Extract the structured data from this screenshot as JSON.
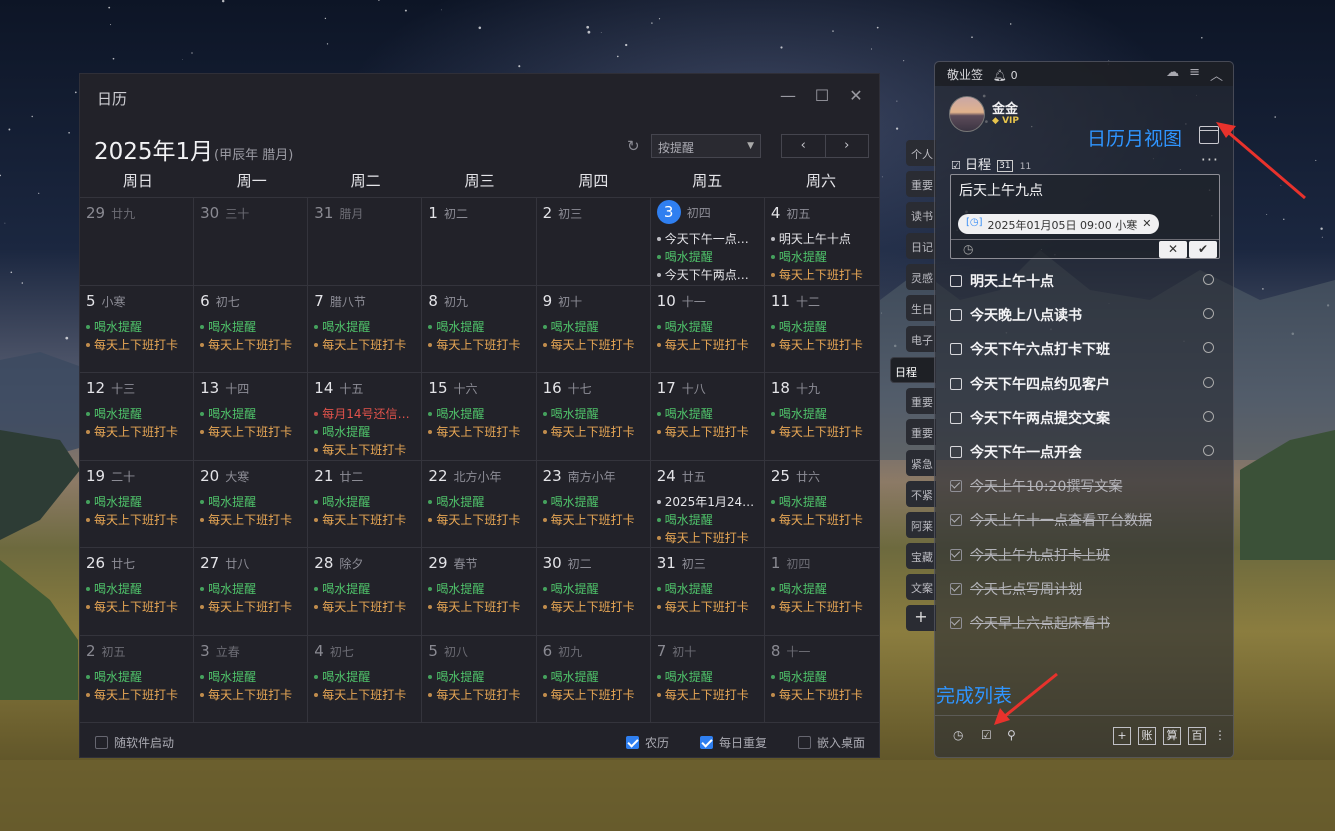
{
  "calendar_window": {
    "title": "日历",
    "month_title": "2025年1月",
    "lunar_subtitle": "(甲辰年 腊月)",
    "filter_select": "按提醒",
    "prev_label": "‹",
    "next_label": "›",
    "weekdays": [
      "周日",
      "周一",
      "周二",
      "周三",
      "周四",
      "周五",
      "周六"
    ],
    "cells": [
      {
        "day": "29",
        "lunar": "廿九",
        "other": true,
        "events": []
      },
      {
        "day": "30",
        "lunar": "三十",
        "other": true,
        "events": []
      },
      {
        "day": "31",
        "lunar": "腊月",
        "other": true,
        "events": []
      },
      {
        "day": "1",
        "lunar": "初二",
        "events": []
      },
      {
        "day": "2",
        "lunar": "初三",
        "events": []
      },
      {
        "day": "3",
        "lunar": "初四",
        "today": true,
        "events": [
          {
            "text": "今天下午一点开会",
            "color": "white"
          },
          {
            "text": "喝水提醒",
            "color": "green"
          },
          {
            "text": "今天下午两点提交文案",
            "color": "white"
          }
        ]
      },
      {
        "day": "4",
        "lunar": "初五",
        "events": [
          {
            "text": "明天上午十点",
            "color": "white"
          },
          {
            "text": "喝水提醒",
            "color": "green"
          },
          {
            "text": "每天上下班打卡",
            "color": "orange"
          }
        ]
      },
      {
        "day": "5",
        "lunar": "小寒",
        "events": [
          {
            "text": "喝水提醒",
            "color": "green"
          },
          {
            "text": "每天上下班打卡",
            "color": "orange"
          }
        ]
      },
      {
        "day": "6",
        "lunar": "初七",
        "events": [
          {
            "text": "喝水提醒",
            "color": "green"
          },
          {
            "text": "每天上下班打卡",
            "color": "orange"
          }
        ]
      },
      {
        "day": "7",
        "lunar": "腊八节",
        "events": [
          {
            "text": "喝水提醒",
            "color": "green"
          },
          {
            "text": "每天上下班打卡",
            "color": "orange"
          }
        ]
      },
      {
        "day": "8",
        "lunar": "初九",
        "events": [
          {
            "text": "喝水提醒",
            "color": "green"
          },
          {
            "text": "每天上下班打卡",
            "color": "orange"
          }
        ]
      },
      {
        "day": "9",
        "lunar": "初十",
        "events": [
          {
            "text": "喝水提醒",
            "color": "green"
          },
          {
            "text": "每天上下班打卡",
            "color": "orange"
          }
        ]
      },
      {
        "day": "10",
        "lunar": "十一",
        "events": [
          {
            "text": "喝水提醒",
            "color": "green"
          },
          {
            "text": "每天上下班打卡",
            "color": "orange"
          }
        ]
      },
      {
        "day": "11",
        "lunar": "十二",
        "events": [
          {
            "text": "喝水提醒",
            "color": "green"
          },
          {
            "text": "每天上下班打卡",
            "color": "orange"
          }
        ]
      },
      {
        "day": "12",
        "lunar": "十三",
        "events": [
          {
            "text": "喝水提醒",
            "color": "green"
          },
          {
            "text": "每天上下班打卡",
            "color": "orange"
          }
        ]
      },
      {
        "day": "13",
        "lunar": "十四",
        "events": [
          {
            "text": "喝水提醒",
            "color": "green"
          },
          {
            "text": "每天上下班打卡",
            "color": "orange"
          }
        ]
      },
      {
        "day": "14",
        "lunar": "十五",
        "events": [
          {
            "text": "每月14号还信用卡",
            "color": "red"
          },
          {
            "text": "喝水提醒",
            "color": "green"
          },
          {
            "text": "每天上下班打卡",
            "color": "orange"
          }
        ]
      },
      {
        "day": "15",
        "lunar": "十六",
        "events": [
          {
            "text": "喝水提醒",
            "color": "green"
          },
          {
            "text": "每天上下班打卡",
            "color": "orange"
          }
        ]
      },
      {
        "day": "16",
        "lunar": "十七",
        "events": [
          {
            "text": "喝水提醒",
            "color": "green"
          },
          {
            "text": "每天上下班打卡",
            "color": "orange"
          }
        ]
      },
      {
        "day": "17",
        "lunar": "十八",
        "events": [
          {
            "text": "喝水提醒",
            "color": "green"
          },
          {
            "text": "每天上下班打卡",
            "color": "orange"
          }
        ]
      },
      {
        "day": "18",
        "lunar": "十九",
        "events": [
          {
            "text": "喝水提醒",
            "color": "green"
          },
          {
            "text": "每天上下班打卡",
            "color": "orange"
          }
        ]
      },
      {
        "day": "19",
        "lunar": "二十",
        "events": [
          {
            "text": "喝水提醒",
            "color": "green"
          },
          {
            "text": "每天上下班打卡",
            "color": "orange"
          }
        ]
      },
      {
        "day": "20",
        "lunar": "大寒",
        "events": [
          {
            "text": "喝水提醒",
            "color": "green"
          },
          {
            "text": "每天上下班打卡",
            "color": "orange"
          }
        ]
      },
      {
        "day": "21",
        "lunar": "廿二",
        "events": [
          {
            "text": "喝水提醒",
            "color": "green"
          },
          {
            "text": "每天上下班打卡",
            "color": "orange"
          }
        ]
      },
      {
        "day": "22",
        "lunar": "北方小年",
        "events": [
          {
            "text": "喝水提醒",
            "color": "green"
          },
          {
            "text": "每天上下班打卡",
            "color": "orange"
          }
        ]
      },
      {
        "day": "23",
        "lunar": "南方小年",
        "events": [
          {
            "text": "喝水提醒",
            "color": "green"
          },
          {
            "text": "每天上下班打卡",
            "color": "orange"
          }
        ]
      },
      {
        "day": "24",
        "lunar": "廿五",
        "events": [
          {
            "text": "2025年1月24日…",
            "color": "white"
          },
          {
            "text": "喝水提醒",
            "color": "green"
          },
          {
            "text": "每天上下班打卡",
            "color": "orange"
          }
        ]
      },
      {
        "day": "25",
        "lunar": "廿六",
        "events": [
          {
            "text": "喝水提醒",
            "color": "green"
          },
          {
            "text": "每天上下班打卡",
            "color": "orange"
          }
        ]
      },
      {
        "day": "26",
        "lunar": "廿七",
        "events": [
          {
            "text": "喝水提醒",
            "color": "green"
          },
          {
            "text": "每天上下班打卡",
            "color": "orange"
          }
        ]
      },
      {
        "day": "27",
        "lunar": "廿八",
        "events": [
          {
            "text": "喝水提醒",
            "color": "green"
          },
          {
            "text": "每天上下班打卡",
            "color": "orange"
          }
        ]
      },
      {
        "day": "28",
        "lunar": "除夕",
        "events": [
          {
            "text": "喝水提醒",
            "color": "green"
          },
          {
            "text": "每天上下班打卡",
            "color": "orange"
          }
        ]
      },
      {
        "day": "29",
        "lunar": "春节",
        "events": [
          {
            "text": "喝水提醒",
            "color": "green"
          },
          {
            "text": "每天上下班打卡",
            "color": "orange"
          }
        ]
      },
      {
        "day": "30",
        "lunar": "初二",
        "events": [
          {
            "text": "喝水提醒",
            "color": "green"
          },
          {
            "text": "每天上下班打卡",
            "color": "orange"
          }
        ]
      },
      {
        "day": "31",
        "lunar": "初三",
        "events": [
          {
            "text": "喝水提醒",
            "color": "green"
          },
          {
            "text": "每天上下班打卡",
            "color": "orange"
          }
        ]
      },
      {
        "day": "1",
        "lunar": "初四",
        "other": true,
        "events": [
          {
            "text": "喝水提醒",
            "color": "green"
          },
          {
            "text": "每天上下班打卡",
            "color": "orange"
          }
        ]
      },
      {
        "day": "2",
        "lunar": "初五",
        "other": true,
        "events": [
          {
            "text": "喝水提醒",
            "color": "green"
          },
          {
            "text": "每天上下班打卡",
            "color": "orange"
          }
        ]
      },
      {
        "day": "3",
        "lunar": "立春",
        "other": true,
        "events": [
          {
            "text": "喝水提醒",
            "color": "green"
          },
          {
            "text": "每天上下班打卡",
            "color": "orange"
          }
        ]
      },
      {
        "day": "4",
        "lunar": "初七",
        "other": true,
        "events": [
          {
            "text": "喝水提醒",
            "color": "green"
          },
          {
            "text": "每天上下班打卡",
            "color": "orange"
          }
        ]
      },
      {
        "day": "5",
        "lunar": "初八",
        "other": true,
        "events": [
          {
            "text": "喝水提醒",
            "color": "green"
          },
          {
            "text": "每天上下班打卡",
            "color": "orange"
          }
        ]
      },
      {
        "day": "6",
        "lunar": "初九",
        "other": true,
        "events": [
          {
            "text": "喝水提醒",
            "color": "green"
          },
          {
            "text": "每天上下班打卡",
            "color": "orange"
          }
        ]
      },
      {
        "day": "7",
        "lunar": "初十",
        "other": true,
        "events": [
          {
            "text": "喝水提醒",
            "color": "green"
          },
          {
            "text": "每天上下班打卡",
            "color": "orange"
          }
        ]
      },
      {
        "day": "8",
        "lunar": "十一",
        "other": true,
        "events": [
          {
            "text": "喝水提醒",
            "color": "green"
          },
          {
            "text": "每天上下班打卡",
            "color": "orange"
          }
        ]
      }
    ],
    "footer": {
      "launch_with_app": "随软件启动",
      "lunar_label": "农历",
      "daily_repeat_label": "每日重复",
      "embed_desktop_label": "嵌入桌面"
    }
  },
  "side_tabs": [
    "个人",
    "重要",
    "读书",
    "日记",
    "灵感",
    "生日",
    "电子",
    "日程",
    "重要",
    "重要",
    "紧急",
    "不紧",
    "阿莱",
    "宝藏",
    "文案",
    "+"
  ],
  "side_tab_active_index": 7,
  "note_panel": {
    "app_name": "敬业签",
    "bell_count": "0",
    "username": "金金",
    "vip_label": "VIP",
    "calendar_view_annotation": "日历月视图",
    "schedule_title": "日程",
    "schedule_icon_text": "31",
    "schedule_count": "11",
    "editor_text": "后天上午九点",
    "date_chip": "2025年01月05日 09:00 小寒",
    "tasks_pending": [
      "明天上午十点",
      "今天晚上八点读书",
      "今天下午六点打卡下班",
      "今天下午四点约见客户",
      "今天下午两点提交文案",
      "今天下午一点开会"
    ],
    "tasks_done": [
      "今天上午10:20撰写文案",
      "今天上午十一点查看平台数据",
      "今天上午九点打卡上班",
      "今天七点写周计划",
      "今天早上六点起床看书"
    ],
    "done_list_annotation": "完成列表",
    "bottom_buttons": [
      "账",
      "算",
      "百"
    ]
  },
  "colors": {
    "accent": "#2f7ff0",
    "annotation": "#2f95ff",
    "green": "#4fc36a",
    "orange": "#e9a855",
    "red": "#e2534b"
  }
}
